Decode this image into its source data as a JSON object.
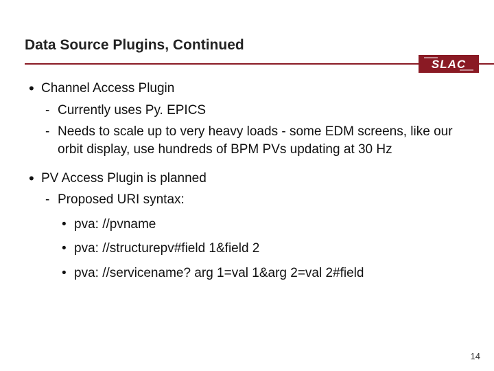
{
  "title": "Data Source Plugins, Continued",
  "logo_text": "SLAC",
  "bullets": {
    "b1a": "Channel Access Plugin",
    "b1a_sub1": "Currently uses Py. EPICS",
    "b1a_sub2": "Needs to scale up to very heavy loads - some EDM screens, like our orbit display, use hundreds of BPM PVs updating at 30 Hz",
    "b1b": "PV Access Plugin is planned",
    "b1b_sub1": "Proposed URI syntax:",
    "uri1": "pva: //pvname",
    "uri2": "pva: //structurepv#field 1&field 2",
    "uri3": "pva: //servicename? arg 1=val 1&arg 2=val 2#field"
  },
  "page_number": "14",
  "colors": {
    "accent": "#8a1a24"
  }
}
